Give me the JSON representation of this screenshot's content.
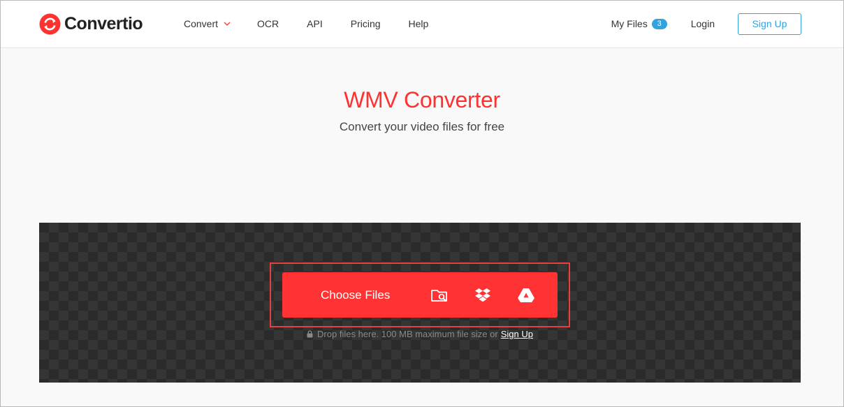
{
  "brand": {
    "name": "Convertio",
    "color": "#ff3232"
  },
  "nav": {
    "convert": "Convert",
    "ocr": "OCR",
    "api": "API",
    "pricing": "Pricing",
    "help": "Help"
  },
  "account": {
    "my_files": "My Files",
    "files_count": "3",
    "login": "Login",
    "signup": "Sign Up"
  },
  "hero": {
    "title": "WMV Converter",
    "subtitle": "Convert your video files for free"
  },
  "upload": {
    "choose_label": "Choose Files",
    "sources": [
      "folder-search-icon",
      "dropbox-icon",
      "google-drive-icon"
    ],
    "hint": "Drop files here. 100 MB maximum file size or",
    "hint_link": "Sign Up"
  },
  "colors": {
    "accent": "#ff3333",
    "link": "#30a3e0",
    "drop_bg": "#2b2b2b"
  }
}
